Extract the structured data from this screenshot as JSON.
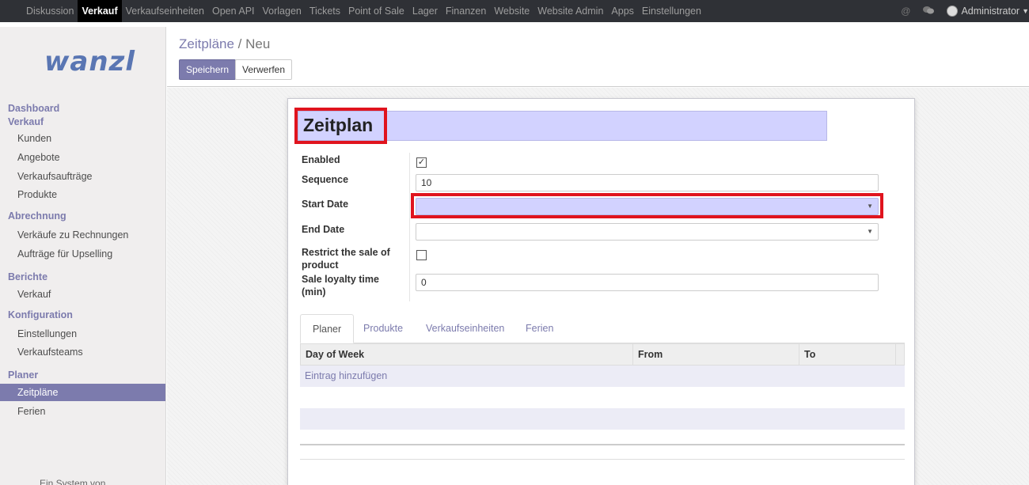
{
  "topnav": {
    "items": [
      "Diskussion",
      "Verkauf",
      "Verkaufseinheiten",
      "Open API",
      "Vorlagen",
      "Tickets",
      "Point of Sale",
      "Lager",
      "Finanzen",
      "Website",
      "Website Admin",
      "Apps",
      "Einstellungen"
    ],
    "active": "Verkauf",
    "user": "Administrator"
  },
  "sidebar": {
    "logo": "wanzl",
    "dashboard": "Dashboard",
    "verkauf": "Verkauf",
    "verkauf_items": [
      "Kunden",
      "Angebote",
      "Verkaufsaufträge",
      "Produkte"
    ],
    "abrechnung": "Abrechnung",
    "abrechnung_items": [
      "Verkäufe zu Rechnungen",
      "Aufträge für Upselling"
    ],
    "berichte": "Berichte",
    "berichte_items": [
      "Verkauf"
    ],
    "konfiguration": "Konfiguration",
    "konfiguration_items": [
      "Einstellungen",
      "Verkaufsteams"
    ],
    "planer": "Planer",
    "planer_items": [
      "Zeitpläne",
      "Ferien"
    ],
    "footer": "Ein System von"
  },
  "control": {
    "breadcrumb_parent": "Zeitpläne",
    "breadcrumb_sep": "/",
    "breadcrumb_current": "Neu",
    "save_label": "Speichern",
    "discard_label": "Verwerfen"
  },
  "form": {
    "title": "Zeitplan",
    "enabled_label": "Enabled",
    "enabled_checked": true,
    "sequence_label": "Sequence",
    "sequence_value": "10",
    "start_date_label": "Start Date",
    "start_date_value": "",
    "end_date_label": "End Date",
    "end_date_value": "",
    "restrict_label": "Restrict the sale of product",
    "restrict_checked": false,
    "loyalty_label": "Sale loyalty time (min)",
    "loyalty_value": "0"
  },
  "notebook": {
    "tabs": [
      "Planer",
      "Produkte",
      "Verkaufseinheiten",
      "Ferien"
    ],
    "active_tab": "Planer",
    "columns": [
      "Day of Week",
      "From",
      "To"
    ],
    "add_row_label": "Eintrag hinzufügen"
  },
  "colors": {
    "accent": "#7c7bad",
    "required_field": "#d2d2ff",
    "highlight": "#e0141e"
  }
}
